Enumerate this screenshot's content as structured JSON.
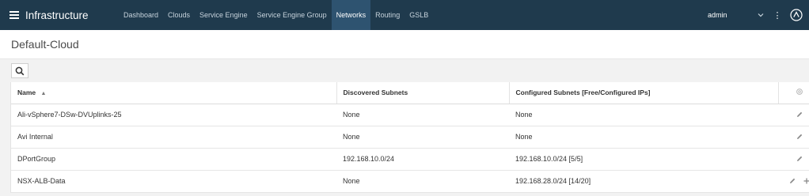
{
  "app": {
    "title": "Infrastructure"
  },
  "nav": {
    "items": [
      {
        "label": "Dashboard"
      },
      {
        "label": "Clouds"
      },
      {
        "label": "Service Engine"
      },
      {
        "label": "Service Engine Group"
      },
      {
        "label": "Networks"
      },
      {
        "label": "Routing"
      },
      {
        "label": "GSLB"
      }
    ],
    "active": "Networks"
  },
  "user": {
    "name": "admin"
  },
  "page": {
    "title": "Default-Cloud"
  },
  "table": {
    "columns": [
      {
        "label": "Name"
      },
      {
        "label": "Discovered Subnets"
      },
      {
        "label": "Configured Subnets [Free/Configured IPs]"
      }
    ],
    "rows": [
      {
        "name": "Ali-vSphere7-DSw-DVUplinks-25",
        "discovered": "None",
        "configured": "None"
      },
      {
        "name": "Avi Internal",
        "discovered": "None",
        "configured": "None"
      },
      {
        "name": "DPortGroup",
        "discovered": "192.168.10.0/24",
        "configured": "192.168.10.0/24 [5/5]"
      },
      {
        "name": "NSX-ALB-Data",
        "discovered": "None",
        "configured": "192.168.28.0/24 [14/20]"
      }
    ]
  },
  "colors": {
    "topbar": "#1f3a4d",
    "nav_active": "#2e5370",
    "panel_bg": "#f2f2f2"
  },
  "icons": {
    "menu": "hamburger-icon",
    "search": "search-icon",
    "sort": "sort-ascending-icon",
    "settings": "gear-icon",
    "edit": "pencil-icon",
    "add": "plus-icon",
    "user_menu": "chevron-down-icon",
    "more": "kebab-icon",
    "logo": "avi-logo-icon"
  }
}
